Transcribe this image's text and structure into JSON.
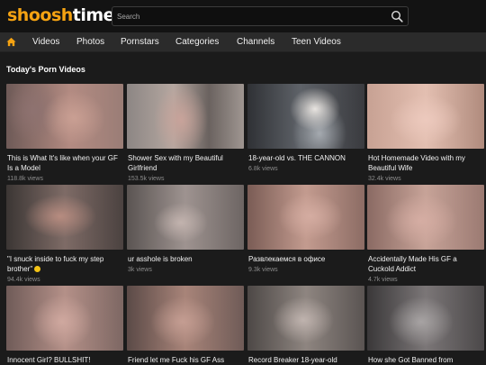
{
  "header": {
    "logo_part1": "shoosh",
    "logo_part2": "time",
    "search_placeholder": "Search"
  },
  "nav": {
    "home_icon": "home-icon",
    "items": [
      "Videos",
      "Photos",
      "Pornstars",
      "Categories",
      "Channels",
      "Teen Videos"
    ]
  },
  "section": {
    "title": "Today's Porn Videos"
  },
  "videos": [
    {
      "title": "This is What It's like when your GF Is a Model",
      "views": "118.8k views"
    },
    {
      "title": "Shower Sex with my Beautiful Girlfriend",
      "views": "153.5k views"
    },
    {
      "title": "18-year-old vs. THE CANNON",
      "views": "6.8k views"
    },
    {
      "title": "Hot Homemade Video with my Beautiful Wife",
      "views": "32.4k views"
    },
    {
      "title": "\"I snuck inside to fuck my step brother\"",
      "views": "94.4k views"
    },
    {
      "title": "ur asshole is broken",
      "views": "3k views"
    },
    {
      "title": "Развлекаемся в офисе",
      "views": "9.3k views"
    },
    {
      "title": "Accidentally Made His GF a Cuckold Addict",
      "views": "4.7k views"
    },
    {
      "title": "Innocent Girl? BULLSHIT!",
      "views": ""
    },
    {
      "title": "Friend let me Fuck his GF Ass",
      "views": ""
    },
    {
      "title": "Record Breaker 18-year-old",
      "views": ""
    },
    {
      "title": "How she Got Banned from",
      "views": ""
    }
  ],
  "colors": {
    "accent": "#f5a312",
    "background": "#1b1b1b",
    "nav_bg": "#2b2b2b"
  }
}
